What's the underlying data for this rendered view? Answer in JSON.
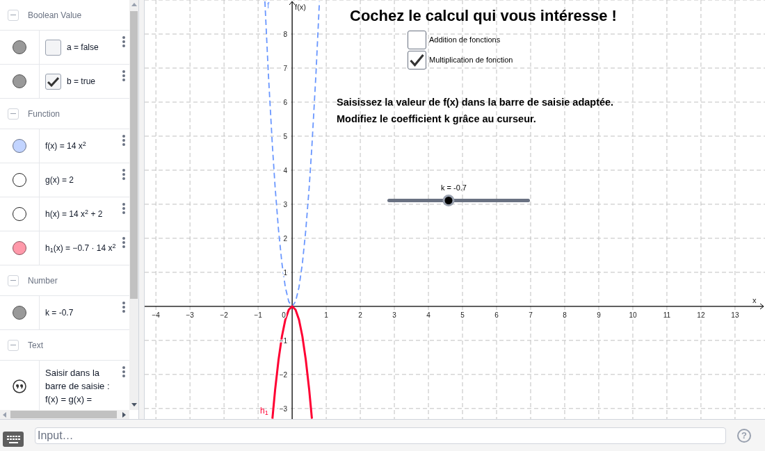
{
  "algebra_view": {
    "sections": [
      {
        "title": "Boolean Value",
        "expanded": true,
        "items": [
          {
            "kind": "boolean",
            "color": "#999999",
            "shown": true,
            "checked": false,
            "text": "a = false"
          },
          {
            "kind": "boolean",
            "color": "#999999",
            "shown": true,
            "checked": true,
            "text": "b = true"
          }
        ]
      },
      {
        "title": "Function",
        "expanded": true,
        "items": [
          {
            "kind": "function",
            "color": "#c2d4ff",
            "shown": true,
            "text": "f(x) = 14 x$^{2}$"
          },
          {
            "kind": "function",
            "shown": false,
            "text": "g(x) = 2"
          },
          {
            "kind": "function",
            "shown": false,
            "text": "h(x) = 14 x$^{2}$ + 2"
          },
          {
            "kind": "function",
            "color": "#ff99aa",
            "shown": true,
            "text": "h$_{1}$(x) = −0.7 · 14 x$^{2}$"
          }
        ]
      },
      {
        "title": "Number",
        "expanded": true,
        "items": [
          {
            "kind": "number",
            "color": "#999999",
            "shown": true,
            "text": "k = -0.7"
          }
        ]
      },
      {
        "title": "Text",
        "expanded": true,
        "items": [
          {
            "kind": "text",
            "text": "Saisir dans la barre de saisie : f(x) = g(x) ="
          }
        ]
      }
    ]
  },
  "graph": {
    "title": "Cochez le calcul qui vous intéresse !",
    "checkboxes": [
      {
        "label": "Addition de fonctions",
        "checked": false
      },
      {
        "label": "Multiplication de fonction",
        "checked": true
      }
    ],
    "instructions": [
      "Saisissez la valeur de f(x) dans la barre de saisie adaptée.",
      "Modifiez le coefficient k grâce au curseur."
    ],
    "slider": {
      "label": "k = -0.7",
      "level": 0.43
    },
    "origin_label": "0",
    "chart_data": {
      "type": "line",
      "grid": true,
      "xlabel": "x",
      "ylabel": "f(x)",
      "xlim": [
        -4.33,
        13.88
      ],
      "ylim": [
        -3.31,
        9.0
      ],
      "xticks": [
        {
          "value": -4,
          "label": "−4"
        },
        {
          "value": -3,
          "label": "−3"
        },
        {
          "value": -2,
          "label": "−2"
        },
        {
          "value": -1,
          "label": "−1"
        },
        1,
        2,
        3,
        4,
        5,
        6,
        7,
        8,
        9,
        10,
        11,
        12,
        13
      ],
      "yticks": [
        {
          "value": -3,
          "label": "−3"
        },
        {
          "value": -2,
          "label": "−2"
        },
        {
          "value": -1,
          "label": "−1"
        },
        1,
        2,
        3,
        4,
        5,
        6,
        7,
        8
      ],
      "x": [
        -0.8,
        -0.7,
        -0.58,
        -0.5,
        -0.4,
        -0.3,
        -0.2,
        -0.1,
        0,
        0.1,
        0.2,
        0.3,
        0.4,
        0.5,
        0.58,
        0.7,
        0.8
      ],
      "series": [
        {
          "name": "f",
          "color": "#6a97ff",
          "line_style": "dashed",
          "values": [
            8.96,
            6.86,
            4.71,
            3.5,
            2.24,
            1.26,
            0.56,
            0.14,
            0,
            0.14,
            0.56,
            1.26,
            2.24,
            3.5,
            4.71,
            6.86,
            8.96
          ]
        },
        {
          "name": "h$_{1}$",
          "color": "#ff0033",
          "line_style": "solid",
          "values": [
            null,
            null,
            -3.3,
            -2.45,
            -1.57,
            -0.88,
            -0.39,
            -0.1,
            0,
            -0.1,
            -0.39,
            -0.88,
            -1.57,
            -2.45,
            -3.3,
            null,
            null
          ]
        }
      ]
    }
  },
  "input_bar": {
    "placeholder": "Input…",
    "help": "?"
  }
}
